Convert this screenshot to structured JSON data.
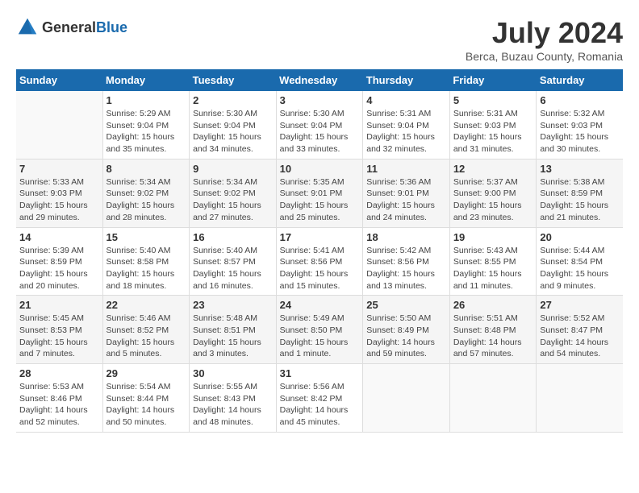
{
  "header": {
    "logo_general": "General",
    "logo_blue": "Blue",
    "title": "July 2024",
    "subtitle": "Berca, Buzau County, Romania"
  },
  "calendar": {
    "days_of_week": [
      "Sunday",
      "Monday",
      "Tuesday",
      "Wednesday",
      "Thursday",
      "Friday",
      "Saturday"
    ],
    "weeks": [
      [
        {
          "day": "",
          "info": ""
        },
        {
          "day": "1",
          "info": "Sunrise: 5:29 AM\nSunset: 9:04 PM\nDaylight: 15 hours\nand 35 minutes."
        },
        {
          "day": "2",
          "info": "Sunrise: 5:30 AM\nSunset: 9:04 PM\nDaylight: 15 hours\nand 34 minutes."
        },
        {
          "day": "3",
          "info": "Sunrise: 5:30 AM\nSunset: 9:04 PM\nDaylight: 15 hours\nand 33 minutes."
        },
        {
          "day": "4",
          "info": "Sunrise: 5:31 AM\nSunset: 9:04 PM\nDaylight: 15 hours\nand 32 minutes."
        },
        {
          "day": "5",
          "info": "Sunrise: 5:31 AM\nSunset: 9:03 PM\nDaylight: 15 hours\nand 31 minutes."
        },
        {
          "day": "6",
          "info": "Sunrise: 5:32 AM\nSunset: 9:03 PM\nDaylight: 15 hours\nand 30 minutes."
        }
      ],
      [
        {
          "day": "7",
          "info": "Sunrise: 5:33 AM\nSunset: 9:03 PM\nDaylight: 15 hours\nand 29 minutes."
        },
        {
          "day": "8",
          "info": "Sunrise: 5:34 AM\nSunset: 9:02 PM\nDaylight: 15 hours\nand 28 minutes."
        },
        {
          "day": "9",
          "info": "Sunrise: 5:34 AM\nSunset: 9:02 PM\nDaylight: 15 hours\nand 27 minutes."
        },
        {
          "day": "10",
          "info": "Sunrise: 5:35 AM\nSunset: 9:01 PM\nDaylight: 15 hours\nand 25 minutes."
        },
        {
          "day": "11",
          "info": "Sunrise: 5:36 AM\nSunset: 9:01 PM\nDaylight: 15 hours\nand 24 minutes."
        },
        {
          "day": "12",
          "info": "Sunrise: 5:37 AM\nSunset: 9:00 PM\nDaylight: 15 hours\nand 23 minutes."
        },
        {
          "day": "13",
          "info": "Sunrise: 5:38 AM\nSunset: 8:59 PM\nDaylight: 15 hours\nand 21 minutes."
        }
      ],
      [
        {
          "day": "14",
          "info": "Sunrise: 5:39 AM\nSunset: 8:59 PM\nDaylight: 15 hours\nand 20 minutes."
        },
        {
          "day": "15",
          "info": "Sunrise: 5:40 AM\nSunset: 8:58 PM\nDaylight: 15 hours\nand 18 minutes."
        },
        {
          "day": "16",
          "info": "Sunrise: 5:40 AM\nSunset: 8:57 PM\nDaylight: 15 hours\nand 16 minutes."
        },
        {
          "day": "17",
          "info": "Sunrise: 5:41 AM\nSunset: 8:56 PM\nDaylight: 15 hours\nand 15 minutes."
        },
        {
          "day": "18",
          "info": "Sunrise: 5:42 AM\nSunset: 8:56 PM\nDaylight: 15 hours\nand 13 minutes."
        },
        {
          "day": "19",
          "info": "Sunrise: 5:43 AM\nSunset: 8:55 PM\nDaylight: 15 hours\nand 11 minutes."
        },
        {
          "day": "20",
          "info": "Sunrise: 5:44 AM\nSunset: 8:54 PM\nDaylight: 15 hours\nand 9 minutes."
        }
      ],
      [
        {
          "day": "21",
          "info": "Sunrise: 5:45 AM\nSunset: 8:53 PM\nDaylight: 15 hours\nand 7 minutes."
        },
        {
          "day": "22",
          "info": "Sunrise: 5:46 AM\nSunset: 8:52 PM\nDaylight: 15 hours\nand 5 minutes."
        },
        {
          "day": "23",
          "info": "Sunrise: 5:48 AM\nSunset: 8:51 PM\nDaylight: 15 hours\nand 3 minutes."
        },
        {
          "day": "24",
          "info": "Sunrise: 5:49 AM\nSunset: 8:50 PM\nDaylight: 15 hours\nand 1 minute."
        },
        {
          "day": "25",
          "info": "Sunrise: 5:50 AM\nSunset: 8:49 PM\nDaylight: 14 hours\nand 59 minutes."
        },
        {
          "day": "26",
          "info": "Sunrise: 5:51 AM\nSunset: 8:48 PM\nDaylight: 14 hours\nand 57 minutes."
        },
        {
          "day": "27",
          "info": "Sunrise: 5:52 AM\nSunset: 8:47 PM\nDaylight: 14 hours\nand 54 minutes."
        }
      ],
      [
        {
          "day": "28",
          "info": "Sunrise: 5:53 AM\nSunset: 8:46 PM\nDaylight: 14 hours\nand 52 minutes."
        },
        {
          "day": "29",
          "info": "Sunrise: 5:54 AM\nSunset: 8:44 PM\nDaylight: 14 hours\nand 50 minutes."
        },
        {
          "day": "30",
          "info": "Sunrise: 5:55 AM\nSunset: 8:43 PM\nDaylight: 14 hours\nand 48 minutes."
        },
        {
          "day": "31",
          "info": "Sunrise: 5:56 AM\nSunset: 8:42 PM\nDaylight: 14 hours\nand 45 minutes."
        },
        {
          "day": "",
          "info": ""
        },
        {
          "day": "",
          "info": ""
        },
        {
          "day": "",
          "info": ""
        }
      ]
    ]
  }
}
